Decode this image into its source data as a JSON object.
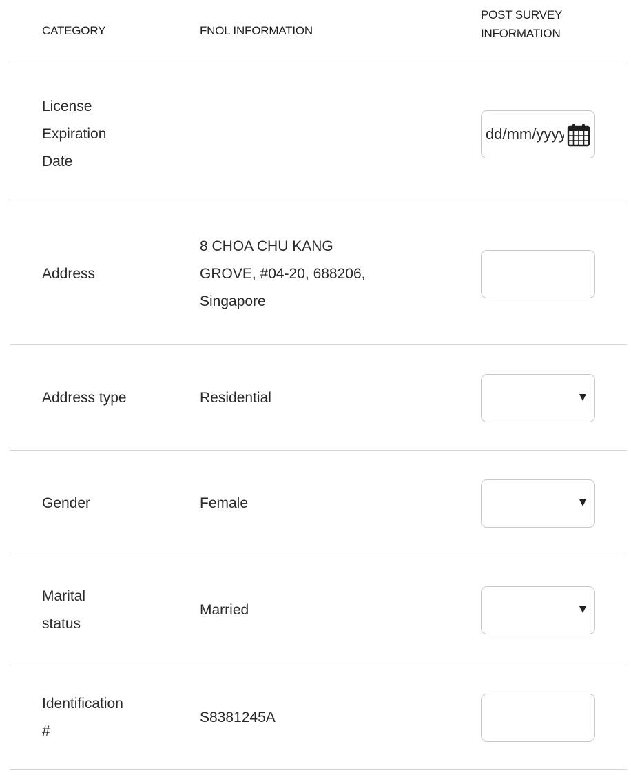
{
  "header": {
    "category": "CATEGORY",
    "fnol": "FNOL INFORMATION",
    "post_survey": "POST SURVEY\nINFORMATION"
  },
  "rows": [
    {
      "category": "License\nExpiration\nDate",
      "fnol": "",
      "post": {
        "kind": "date",
        "placeholder": "dd/mm/yyyy",
        "icon": "calendar-icon"
      }
    },
    {
      "category": "Address",
      "fnol": "8 CHOA CHU KANG\nGROVE, #04-20, 688206,\nSingapore",
      "post": {
        "kind": "text",
        "value": ""
      }
    },
    {
      "category": "Address type",
      "fnol": "Residential",
      "post": {
        "kind": "select",
        "value": "",
        "icon": "dropdown-caret-icon"
      }
    },
    {
      "category": "Gender",
      "fnol": "Female",
      "post": {
        "kind": "select",
        "value": "",
        "icon": "dropdown-caret-icon"
      }
    },
    {
      "category": "Marital\nstatus",
      "fnol": "Married",
      "post": {
        "kind": "select",
        "value": "",
        "icon": "dropdown-caret-icon"
      }
    },
    {
      "category": "Identification\n#",
      "fnol": "S8381245A",
      "post": {
        "kind": "text",
        "value": ""
      }
    }
  ],
  "colors": {
    "text": "#2a2a2a",
    "divider": "#d7d7d7",
    "field_border": "#c9c9c9"
  }
}
